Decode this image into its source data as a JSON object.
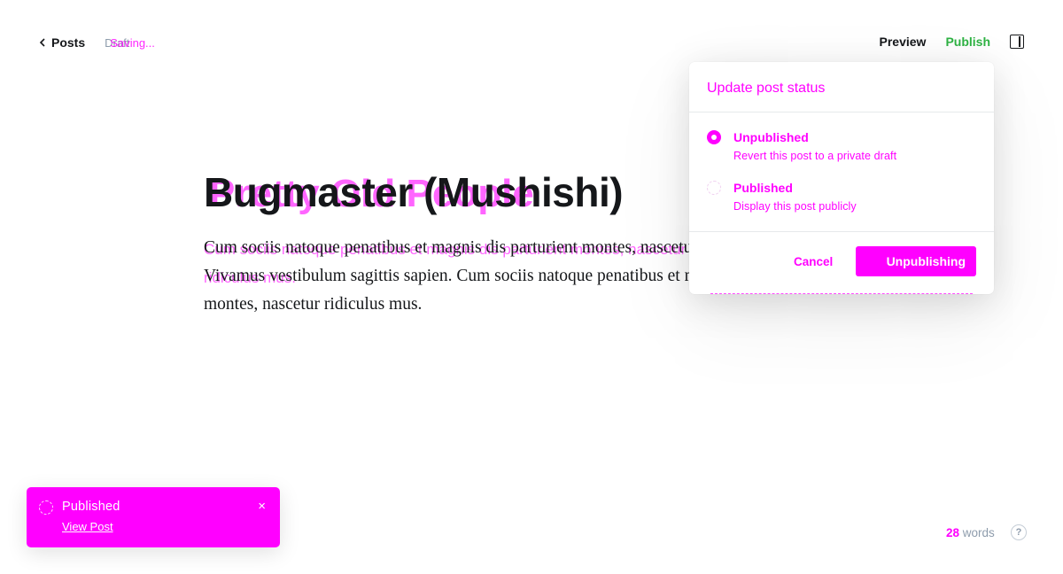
{
  "header": {
    "back_label": "Posts",
    "status": "Draft",
    "status_overlay": "Saving...",
    "preview_label": "Preview",
    "publish_label": "Publish"
  },
  "post": {
    "title": "Bugmaster (Mushishi)",
    "title_overlay": "Pretty Old People",
    "body": "Cum sociis natoque penatibus et magnis dis parturient montes, nascetur ridiculus mus. Vivamus vestibulum sagittis sapien. Cum sociis natoque penatibus et magnis dis parturient montes, nascetur ridiculus mus.",
    "body_overlay": "Cum sociis natoque penatibus et magnis dis parturient montes, nascetur ridiculus mus."
  },
  "popover": {
    "title": "Update post status",
    "options": [
      {
        "label": "Unpublished",
        "description": "Revert this post to a private draft",
        "selected": true
      },
      {
        "label": "Published",
        "description": "Display this post publicly",
        "selected": false
      }
    ],
    "cancel_label": "Cancel",
    "action_label": "Unpublishing"
  },
  "toast": {
    "title": "Published",
    "link": "View Post",
    "close": "×"
  },
  "footer": {
    "word_count": "28",
    "word_label": "words",
    "help": "?"
  },
  "colors": {
    "accent": "#ff00ff",
    "publish_green": "#2fb344",
    "text": "#15171a",
    "muted": "#8e9cac"
  }
}
